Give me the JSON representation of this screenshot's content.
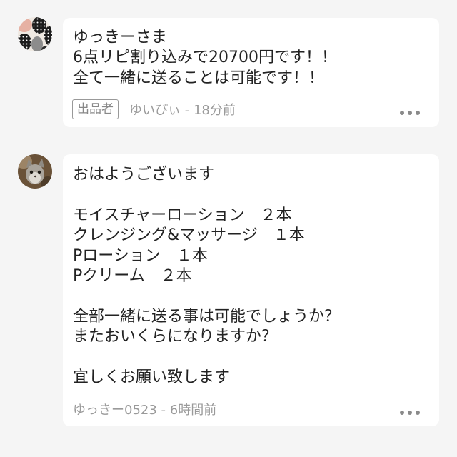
{
  "colors": {
    "background": "#f5f5f5",
    "card": "#ffffff",
    "text": "#222222",
    "meta": "#9a9a9a",
    "badge_border": "#999999",
    "badge_text": "#888888",
    "menu_dots": "#8a8a8a"
  },
  "comments": [
    {
      "avatar_icon": "patterned-avatar-icon",
      "paragraphs": [
        [
          "ゆっきーさま",
          "6点リピ割り込みで20700円です！！",
          "全て一緒に送ることは可能です！！"
        ]
      ],
      "badge": "出品者",
      "author": "ゆいぴぃ",
      "separator": " - ",
      "time": "18分前",
      "menu_icon": "more-icon"
    },
    {
      "avatar_icon": "cat-photo-avatar-icon",
      "paragraphs": [
        [
          "おはようございます"
        ],
        [
          "モイスチャーローション　２本",
          "クレンジング&マッサージ　１本",
          "Pローション　１本",
          "Pクリーム　２本"
        ],
        [
          "全部一緒に送る事は可能でしょうか？",
          "またおいくらになりますか？"
        ],
        [
          "宜しくお願い致します"
        ]
      ],
      "author": "ゆっきー0523",
      "separator": " - ",
      "time": "6時間前",
      "menu_icon": "more-icon"
    }
  ]
}
